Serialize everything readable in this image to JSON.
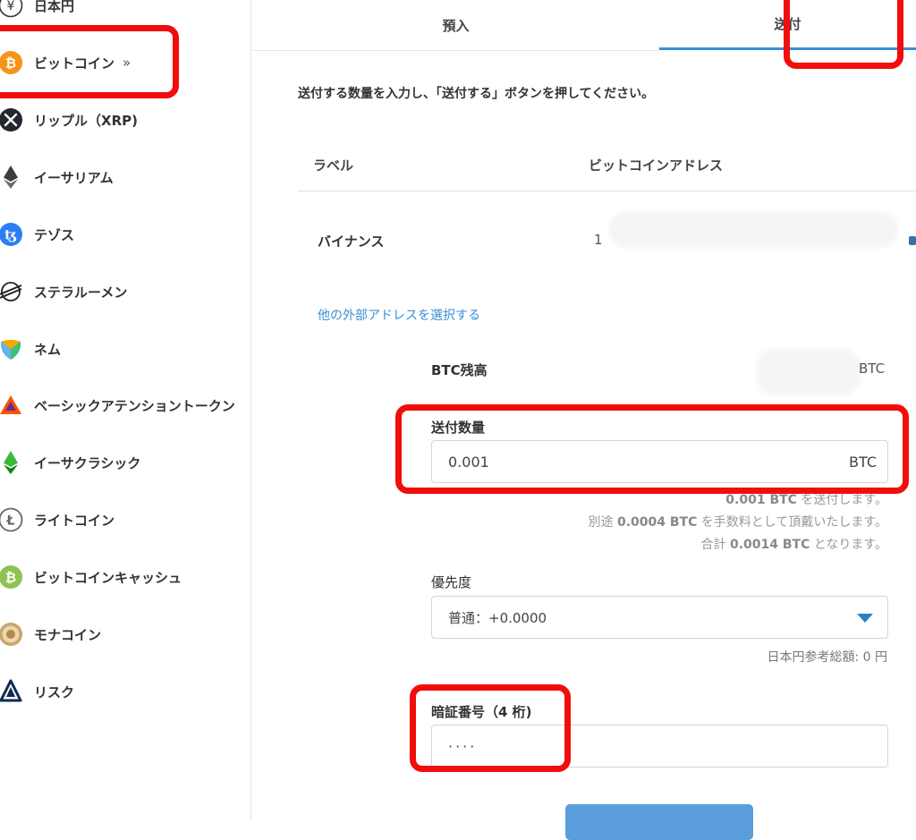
{
  "sidebar": {
    "items": [
      {
        "label": "日本円",
        "icon": "yen-icon"
      },
      {
        "label": "ビットコイン",
        "icon": "bitcoin-icon",
        "selected": true
      },
      {
        "label": "リップル（XRP)",
        "icon": "ripple-icon"
      },
      {
        "label": "イーサリアム",
        "icon": "ethereum-icon"
      },
      {
        "label": "テゾス",
        "icon": "tezos-icon"
      },
      {
        "label": "ステラルーメン",
        "icon": "stellar-icon"
      },
      {
        "label": "ネム",
        "icon": "nem-icon"
      },
      {
        "label": "ベーシックアテンショントークン",
        "icon": "bat-icon"
      },
      {
        "label": "イーサクラシック",
        "icon": "ethereum-classic-icon"
      },
      {
        "label": "ライトコイン",
        "icon": "litecoin-icon"
      },
      {
        "label": "ビットコインキャッシュ",
        "icon": "bitcoin-cash-icon"
      },
      {
        "label": "モナコイン",
        "icon": "monacoin-icon"
      },
      {
        "label": "リスク",
        "icon": "lisk-icon"
      }
    ],
    "selected_chevron": "»"
  },
  "tabs": {
    "deposit": "預入",
    "send": "送付",
    "active": "send"
  },
  "instruction": "送付する数量を入力し、「送付する」ボタンを押してください。",
  "address_table": {
    "headers": [
      "ラベル",
      "ビットコインアドレス"
    ],
    "rows": [
      {
        "label": "バイナンス",
        "address": "1"
      }
    ]
  },
  "other_address_link": "他の外部アドレスを選択する",
  "balance": {
    "label": "BTC残高",
    "unit": "BTC"
  },
  "amount": {
    "label": "送付数量",
    "value": "0.001",
    "unit": "BTC"
  },
  "notes": {
    "send_amount": "0.001 BTC",
    "send_suffix": " を送付します。",
    "fee_prefix": "別途 ",
    "fee_amount": "0.0004 BTC",
    "fee_suffix": " を手数料として頂戴いたします。",
    "total_prefix": "合計 ",
    "total_amount": "0.0014 BTC",
    "total_suffix": " となります。"
  },
  "priority": {
    "label": "優先度",
    "selected": "普通：+0.0000",
    "jpy_total": "日本円参考総額: 0 円"
  },
  "pin": {
    "label": "暗証番号（4 桁)",
    "value": "····"
  },
  "colors": {
    "accent": "#3b8fd4",
    "annotation": "#f20d0d",
    "bitcoin": "#f7931a"
  }
}
